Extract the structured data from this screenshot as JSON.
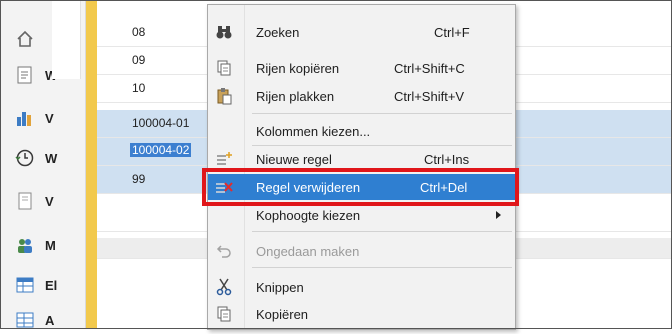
{
  "sidebar": {
    "items": [
      {
        "label": "",
        "icon": "home-icon"
      },
      {
        "label": "W",
        "icon": "document-icon"
      },
      {
        "label": "V",
        "icon": "bar-chart-icon"
      },
      {
        "label": "W",
        "icon": "history-clock-icon"
      },
      {
        "label": "V",
        "icon": "page-icon"
      },
      {
        "label": "M",
        "icon": "users-icon"
      },
      {
        "label": "El",
        "icon": "table-icon"
      },
      {
        "label": "A",
        "icon": "grid-icon"
      }
    ]
  },
  "grid": {
    "rows": [
      {
        "value": "08",
        "selected": false
      },
      {
        "value": "09",
        "selected": false
      },
      {
        "value": "10",
        "selected": false
      },
      {
        "value": "100004-01",
        "selected": true
      },
      {
        "value": "100004-02",
        "selected": true,
        "editing": true
      },
      {
        "value": "99",
        "selected": true
      },
      {
        "value": "",
        "selected": false
      },
      {
        "value": "",
        "selected": false,
        "gray": true
      }
    ]
  },
  "menu": {
    "items": [
      {
        "label": "Zoeken",
        "shortcut": "Ctrl+F",
        "icon": "binoculars-icon"
      },
      {
        "label": "Rijen kopiëren",
        "shortcut": "Ctrl+Shift+C",
        "icon": "copy-rows-icon"
      },
      {
        "label": "Rijen plakken",
        "shortcut": "Ctrl+Shift+V",
        "icon": "paste-icon"
      },
      {
        "label": "Kolommen kiezen...",
        "shortcut": "",
        "icon": ""
      },
      {
        "label": "Nieuwe regel",
        "shortcut": "Ctrl+Ins",
        "icon": "new-row-icon"
      },
      {
        "label": "Regel verwijderen",
        "shortcut": "Ctrl+Del",
        "icon": "delete-row-icon",
        "highlighted": true
      },
      {
        "label": "Kophoogte kiezen",
        "shortcut": "",
        "icon": "",
        "submenu": true
      },
      {
        "label": "Ongedaan maken",
        "shortcut": "",
        "icon": "undo-icon",
        "disabled": true
      },
      {
        "label": "Knippen",
        "shortcut": "",
        "icon": "scissors-icon"
      },
      {
        "label": "Kopiëren",
        "shortcut": "",
        "icon": "copy-icon"
      }
    ]
  },
  "colors": {
    "accent": "#2f7fd1",
    "selection": "#cfe0f1",
    "highlight_box": "#e0161a",
    "strip": "#f2c94c"
  }
}
